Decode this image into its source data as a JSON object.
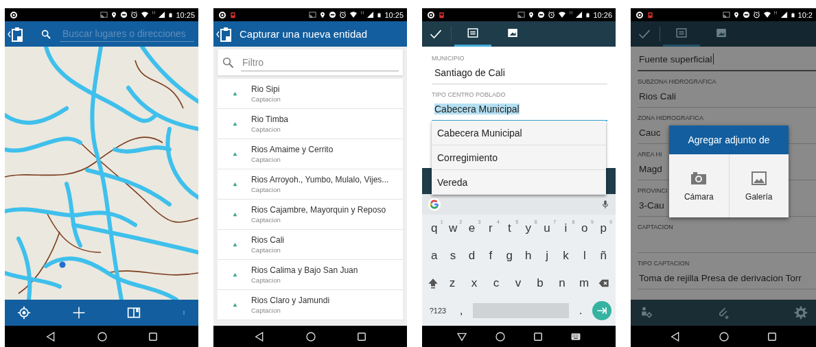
{
  "screens": [
    {
      "kind": "map",
      "status": {
        "notification": false,
        "network": "H",
        "time": "10:25"
      },
      "search": {
        "placeholder": "Buscar lugares o direcciones"
      }
    },
    {
      "kind": "list",
      "status": {
        "notification": true,
        "network": "H",
        "time": "10:25"
      },
      "title": "Capturar una nueva entidad",
      "filter": {
        "placeholder": "Filtro"
      },
      "items": [
        {
          "name": "Rio Sipi",
          "type": "Captacion"
        },
        {
          "name": "Rio Timba",
          "type": "Captacion"
        },
        {
          "name": "Rios Amaime y Cerrito",
          "type": "Captacion"
        },
        {
          "name": "Rios Arroyoh., Yumbo, Mulalo, Vijes...",
          "type": "Captacion"
        },
        {
          "name": "Rios Cajambre, Mayorquin y Reposo",
          "type": "Captacion"
        },
        {
          "name": "Rios Cali",
          "type": "Captacion"
        },
        {
          "name": "Rios Calima y Bajo San Juan",
          "type": "Captacion"
        },
        {
          "name": "Rios Claro y Jamundi",
          "type": "Captacion"
        }
      ]
    },
    {
      "kind": "form",
      "status": {
        "notification": true,
        "network": "H",
        "time": "10:26"
      },
      "tabs": [
        {
          "kind": "form",
          "selected": true
        },
        {
          "kind": "attachments",
          "selected": false
        }
      ],
      "fields": [
        {
          "label": "MUNICIPIO",
          "value": "Santiago de Cali",
          "focused": false,
          "text_selected": false
        },
        {
          "label": "TIPO CENTRO POBLADO",
          "value": "Cabecera Municipal",
          "focused": true,
          "text_selected": true
        }
      ],
      "dropdown": {
        "options": [
          "Cabecera Municipal",
          "Corregimiento",
          "Vereda"
        ]
      },
      "keyboard": {
        "rows": [
          {
            "keys": [
              {
                "label": "q",
                "hint": "1"
              },
              {
                "label": "w",
                "hint": "2"
              },
              {
                "label": "e",
                "hint": "3"
              },
              {
                "label": "r",
                "hint": "4"
              },
              {
                "label": "t",
                "hint": "5"
              },
              {
                "label": "y",
                "hint": "6"
              },
              {
                "label": "u",
                "hint": "7"
              },
              {
                "label": "i",
                "hint": "8"
              },
              {
                "label": "o",
                "hint": "9"
              },
              {
                "label": "p",
                "hint": "0"
              }
            ]
          },
          {
            "keys": [
              {
                "label": "a"
              },
              {
                "label": "s"
              },
              {
                "label": "d"
              },
              {
                "label": "f"
              },
              {
                "label": "g"
              },
              {
                "label": "h"
              },
              {
                "label": "j"
              },
              {
                "label": "k"
              },
              {
                "label": "l"
              },
              {
                "label": "ñ"
              }
            ]
          },
          {
            "keys": [
              {
                "kind": "shift"
              },
              {
                "label": "z"
              },
              {
                "label": "x"
              },
              {
                "label": "c"
              },
              {
                "label": "v"
              },
              {
                "label": "b"
              },
              {
                "label": "n"
              },
              {
                "label": "m"
              },
              {
                "kind": "backspace"
              }
            ]
          }
        ],
        "symbols": "?123",
        "comma": ",",
        "period": "."
      }
    },
    {
      "kind": "form",
      "status": {
        "notification": true,
        "network": "H",
        "time": "10:2"
      },
      "tabs": [
        {
          "kind": "form",
          "selected": true
        },
        {
          "kind": "attachments",
          "selected": false
        }
      ],
      "fields": [
        {
          "value": "Fuente superficial",
          "focused": true,
          "text_selected": false
        },
        {
          "label": "SUBZONA HIDROGRAFICA",
          "value": "Rios Cali",
          "focused": false,
          "text_selected": false
        },
        {
          "label": "ZONA HIDROGRAFICA",
          "value": "Cauc",
          "focused": false,
          "text_selected": false
        },
        {
          "label": "AREA HI",
          "value": "Magd",
          "focused": false,
          "text_selected": false
        },
        {
          "label": "PROVINCI",
          "value": "3-Cau",
          "focused": false,
          "text_selected": false
        },
        {
          "label": "CAPTACION",
          "focused": false
        },
        {
          "label": "TIPO CAPTACION",
          "value": "Toma de rejilla Presa de derivacion Torr",
          "focused": false,
          "text_selected": false
        }
      ],
      "dialog": {
        "title": "Agregar adjunto de",
        "options": [
          {
            "kind": "camera",
            "label": "Cámara"
          },
          {
            "kind": "gallery",
            "label": "Galería"
          }
        ]
      }
    }
  ]
}
